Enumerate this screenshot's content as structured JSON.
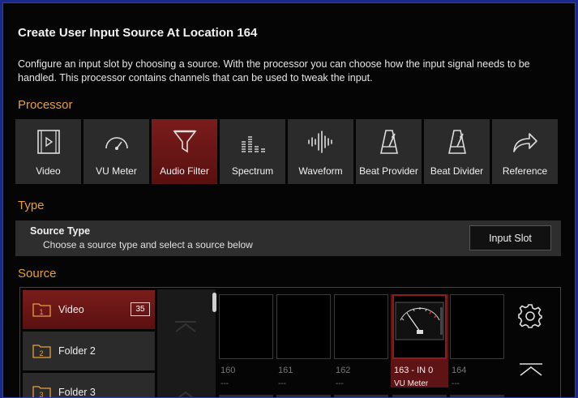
{
  "dialog": {
    "title": "Create User Input Source At Location 164",
    "description": "Configure an input slot by choosing a source. With the processor you can choose how the input signal needs to be handled. This processor contains channels that can be used to tweak the input."
  },
  "processor": {
    "heading": "Processor",
    "items": [
      {
        "label": "Video",
        "icon": "film-play-icon"
      },
      {
        "label": "VU Meter",
        "icon": "gauge-icon"
      },
      {
        "label": "Audio Filter",
        "icon": "funnel-icon",
        "selected": true
      },
      {
        "label": "Spectrum",
        "icon": "spectrum-bars-icon"
      },
      {
        "label": "Waveform",
        "icon": "waveform-icon"
      },
      {
        "label": "Beat Provider",
        "icon": "metronome-icon"
      },
      {
        "label": "Beat Divider",
        "icon": "metronome-icon"
      },
      {
        "label": "Reference",
        "icon": "share-arrow-icon"
      }
    ]
  },
  "type": {
    "heading": "Type",
    "source_type_title": "Source Type",
    "source_type_hint": "Choose a source type and select a source below",
    "input_slot_button": "Input Slot"
  },
  "source": {
    "heading": "Source",
    "folders": [
      {
        "number": "1",
        "name": "Video",
        "count": "35",
        "selected": true
      },
      {
        "number": "2",
        "name": "Folder 2"
      },
      {
        "number": "3",
        "name": "Folder 3"
      }
    ],
    "slots": [
      {
        "number": "160",
        "subtitle": "---"
      },
      {
        "number": "161",
        "subtitle": "---"
      },
      {
        "number": "162",
        "subtitle": "---"
      },
      {
        "number": "163 - IN 0",
        "subtitle": "VU Meter",
        "selected": true
      },
      {
        "number": "164",
        "subtitle": "---"
      }
    ]
  },
  "colors": {
    "accent": "#e8a03a",
    "selected": "#7a1c1c",
    "frame": "#2a3fbf"
  }
}
